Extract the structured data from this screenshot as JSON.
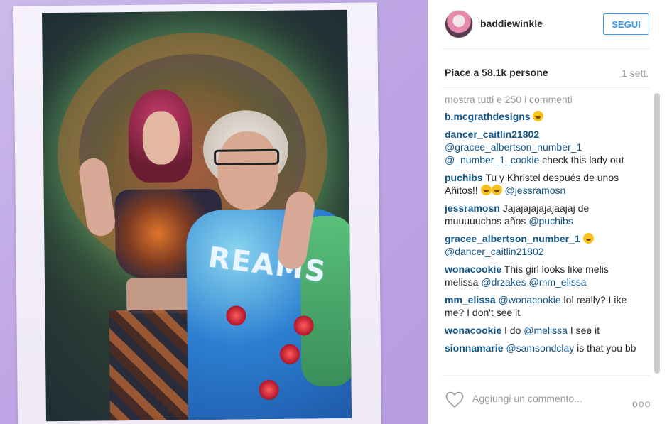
{
  "post": {
    "username": "baddiewinkle",
    "follow_label": "SEGUI",
    "likes": "Piace a 58.1k persone",
    "time": "1 sett.",
    "show_all_comments": "mostra tutti e 250 i commenti",
    "photo_sweater_text": "REAMS",
    "comments": [
      {
        "user": "b.mcgrathdesigns",
        "text": "",
        "emoji": [
          "heart-eyes"
        ]
      },
      {
        "user": "dancer_caitlin21802",
        "mentions": "@gracee_albertson_number_1 @_number_1_cookie",
        "text": " check this lady out"
      },
      {
        "user": "puchibs",
        "text": "Tu y Khristel después de unos Añitos!! ",
        "emoji": [
          "grimace",
          "grimace"
        ],
        "mentions": "@jessramosn"
      },
      {
        "user": "jessramosn",
        "text": "Jajajajajajajaajaj de muuuuuchos años ",
        "mentions": "@puchibs"
      },
      {
        "user": "gracee_albertson_number_1",
        "emoji": [
          "laughing-tears"
        ],
        "mentions": "@dancer_caitlin21802"
      },
      {
        "user": "wonacookie",
        "text": "This girl looks like melis melissa ",
        "mentions": "@drzakes @mm_elissa"
      },
      {
        "user": "mm_elissa",
        "mentions": "@wonacookie",
        "text": " lol really? Like me? I don't see it"
      },
      {
        "user": "wonacookie",
        "text": "I do ",
        "mentions": "@melissa",
        "text2": " I see it"
      },
      {
        "user": "sionnamarie",
        "mentions": "@samsondclay",
        "text": " is that you bb"
      }
    ],
    "add_comment_placeholder": "Aggiungi un commento...",
    "more_label": "ooo"
  },
  "colors": {
    "link": "#125688",
    "button": "#3897f0",
    "muted": "#999999"
  },
  "icons": [
    "avatar",
    "heart-outline-icon",
    "more-options-icon"
  ]
}
